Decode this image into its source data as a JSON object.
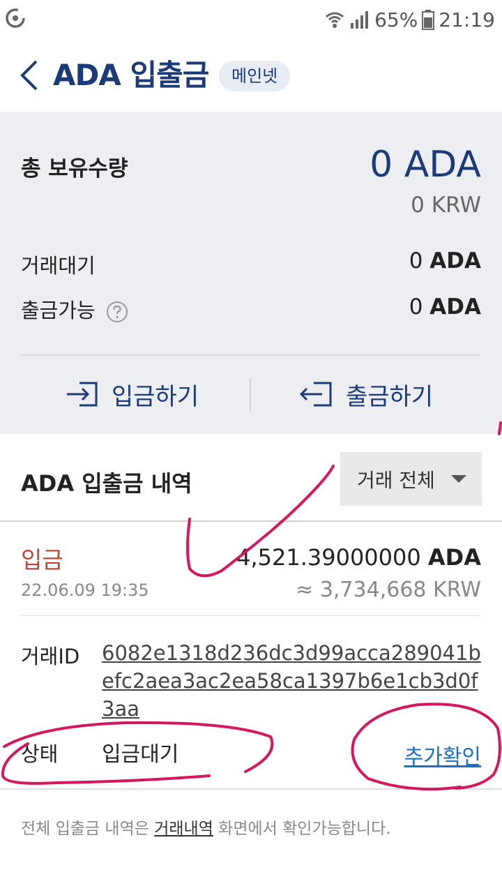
{
  "status_bar": {
    "battery": "65%",
    "time": "21:19"
  },
  "header": {
    "title": "ADA 입출금",
    "network_badge": "메인넷"
  },
  "summary": {
    "total_label": "총 보유수량",
    "total_ada": "0 ADA",
    "total_krw": "0 KRW",
    "pending_label": "거래대기",
    "pending_value": "0",
    "pending_unit": "ADA",
    "withdrawable_label": "출금가능",
    "withdrawable_value": "0",
    "withdrawable_unit": "ADA",
    "deposit_button": "입금하기",
    "withdraw_button": "출금하기"
  },
  "history": {
    "title": "ADA 입출금 내역",
    "filter": "거래 전체",
    "transactions": [
      {
        "type": "입금",
        "date": "22.06.09 19:35",
        "amount": "4,521.39000000",
        "unit": "ADA",
        "krw": "≈ 3,734,668 KRW",
        "txid_label": "거래ID",
        "txid": "6082e1318d236dc3d99acca289041befc2aea3ac2ea58ca1397b6e1cb3d0f3aa",
        "status_label": "상태",
        "status": "입금대기",
        "action": "추가확인"
      }
    ]
  },
  "footnote": {
    "prefix": "전체 입출금 내역은 ",
    "link": "거래내역",
    "suffix": " 화면에서 확인가능합니다."
  },
  "colors": {
    "brand_navy": "#1b3a7a",
    "deposit_red": "#c0463a",
    "link_blue": "#1a6fc4",
    "annotation_pink": "#d6175f"
  }
}
